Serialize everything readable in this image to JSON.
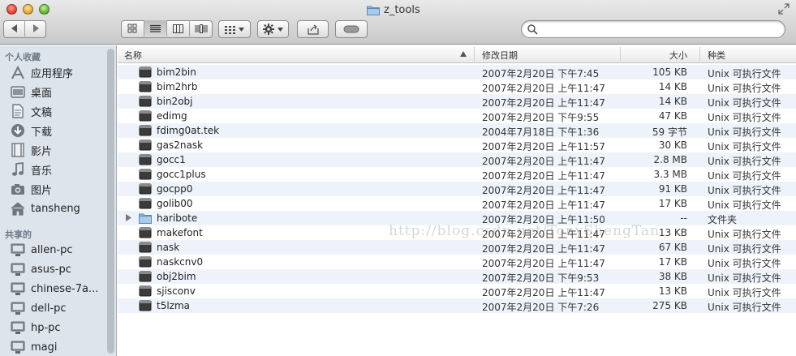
{
  "window": {
    "title": "z_tools",
    "colors": {
      "toolbar_top": "#e9e9e9",
      "toolbar_bottom": "#c9c9c9",
      "sidebar_bg": "#dde4ec",
      "row_alt": "#eef3fb"
    }
  },
  "toolbar": {
    "nav_back_icon": "chevron-left-icon",
    "nav_forward_icon": "chevron-right-icon",
    "view_modes": [
      "icon-view",
      "list-view",
      "column-view",
      "cover-flow-view"
    ],
    "active_view": "list-view",
    "arrange_icon": "grid-arrange-icon",
    "action_icon": "gear-icon",
    "share_icon": "share-icon",
    "tag_icon": "toggle-pill-icon"
  },
  "search": {
    "placeholder": "",
    "value": ""
  },
  "sidebar": {
    "favorites_header": "个人收藏",
    "favorites": [
      {
        "label": "应用程序",
        "icon": "applications-icon"
      },
      {
        "label": "桌面",
        "icon": "desktop-icon"
      },
      {
        "label": "文稿",
        "icon": "documents-icon"
      },
      {
        "label": "下载",
        "icon": "downloads-icon"
      },
      {
        "label": "影片",
        "icon": "movies-icon"
      },
      {
        "label": "音乐",
        "icon": "music-icon"
      },
      {
        "label": "图片",
        "icon": "pictures-icon"
      },
      {
        "label": "tansheng",
        "icon": "home-icon"
      }
    ],
    "shared_header": "共享的",
    "shared": [
      {
        "label": "allen-pc",
        "icon": "pc-monitor-icon"
      },
      {
        "label": "asus-pc",
        "icon": "pc-monitor-icon"
      },
      {
        "label": "chinese-7a...",
        "icon": "pc-monitor-icon"
      },
      {
        "label": "dell-pc",
        "icon": "pc-monitor-icon"
      },
      {
        "label": "hp-pc",
        "icon": "pc-monitor-icon"
      },
      {
        "label": "magi",
        "icon": "pc-monitor-icon"
      }
    ]
  },
  "columns": {
    "name": "名称",
    "date": "修改日期",
    "size": "大小",
    "kind": "种类"
  },
  "files": [
    {
      "name": "bim2bin",
      "date": "2007年2月20日 下午7:45",
      "size": "105 KB",
      "kind": "Unix 可执行文件",
      "type": "exec"
    },
    {
      "name": "bim2hrb",
      "date": "2007年2月20日 上午11:47",
      "size": "14 KB",
      "kind": "Unix 可执行文件",
      "type": "exec"
    },
    {
      "name": "bin2obj",
      "date": "2007年2月20日 上午11:47",
      "size": "14 KB",
      "kind": "Unix 可执行文件",
      "type": "exec"
    },
    {
      "name": "edimg",
      "date": "2007年2月20日 下午9:55",
      "size": "47 KB",
      "kind": "Unix 可执行文件",
      "type": "exec"
    },
    {
      "name": "fdimg0at.tek",
      "date": "2004年7月18日 下午1:36",
      "size": "59 字节",
      "kind": "Unix 可执行文件",
      "type": "exec"
    },
    {
      "name": "gas2nask",
      "date": "2007年2月20日 上午11:57",
      "size": "30 KB",
      "kind": "Unix 可执行文件",
      "type": "exec"
    },
    {
      "name": "gocc1",
      "date": "2007年2月20日 上午11:47",
      "size": "2.8 MB",
      "kind": "Unix 可执行文件",
      "type": "exec"
    },
    {
      "name": "gocc1plus",
      "date": "2007年2月20日 上午11:47",
      "size": "3.3 MB",
      "kind": "Unix 可执行文件",
      "type": "exec"
    },
    {
      "name": "gocpp0",
      "date": "2007年2月20日 上午11:47",
      "size": "91 KB",
      "kind": "Unix 可执行文件",
      "type": "exec"
    },
    {
      "name": "golib00",
      "date": "2007年2月20日 上午11:47",
      "size": "17 KB",
      "kind": "Unix 可执行文件",
      "type": "exec"
    },
    {
      "name": "haribote",
      "date": "2007年2月20日 上午11:50",
      "size": "--",
      "kind": "文件夹",
      "type": "folder"
    },
    {
      "name": "makefont",
      "date": "2007年2月20日 上午11:47",
      "size": "13 KB",
      "kind": "Unix 可执行文件",
      "type": "exec"
    },
    {
      "name": "nask",
      "date": "2007年2月20日 上午11:47",
      "size": "67 KB",
      "kind": "Unix 可执行文件",
      "type": "exec"
    },
    {
      "name": "naskcnv0",
      "date": "2007年2月20日 上午11:47",
      "size": "17 KB",
      "kind": "Unix 可执行文件",
      "type": "exec"
    },
    {
      "name": "obj2bim",
      "date": "2007年2月20日 下午9:53",
      "size": "38 KB",
      "kind": "Unix 可执行文件",
      "type": "exec"
    },
    {
      "name": "sjisconv",
      "date": "2007年2月20日 上午11:47",
      "size": "13 KB",
      "kind": "Unix 可执行文件",
      "type": "exec"
    },
    {
      "name": "t5lzma",
      "date": "2007年2月20日 下午7:26",
      "size": "275 KB",
      "kind": "Unix 可执行文件",
      "type": "exec"
    }
  ],
  "watermark": "http://blog.csdn.net/TonyShengTan"
}
